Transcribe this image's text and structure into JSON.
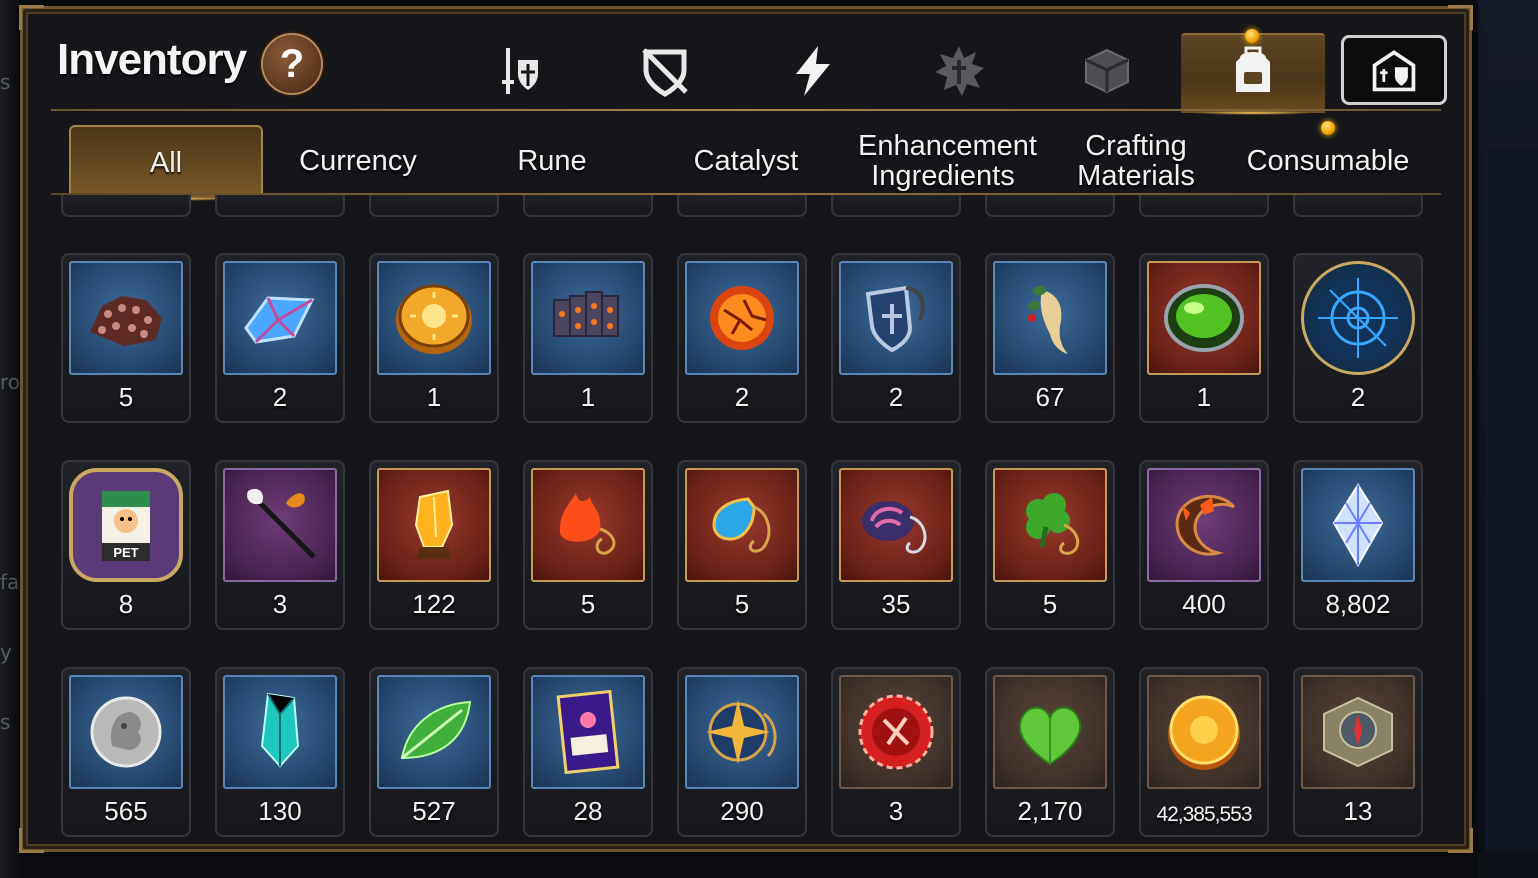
{
  "window": {
    "title": "Inventory",
    "help_label": "?"
  },
  "top_tabs": [
    {
      "icon": "sword-shield-icon"
    },
    {
      "icon": "crossed-shield-icon"
    },
    {
      "icon": "lightning-icon"
    },
    {
      "icon": "spiked-emblem-icon"
    },
    {
      "icon": "cube-icon"
    },
    {
      "icon": "backpack-icon",
      "active": true
    },
    {
      "icon": "castle-icon"
    }
  ],
  "sub_tabs": [
    {
      "label": "All",
      "active": true
    },
    {
      "label": "Currency"
    },
    {
      "label": "Rune"
    },
    {
      "label": "Catalyst"
    },
    {
      "label": "Enhancement Ingredients"
    },
    {
      "label": "Crafting Materials"
    },
    {
      "label": "Consumable"
    }
  ],
  "items": {
    "row1": [
      {
        "icon": "ore-chunk-icon",
        "count": "5"
      },
      {
        "icon": "blue-crystal-icon",
        "count": "2"
      },
      {
        "icon": "sun-coin-icon",
        "count": "1"
      },
      {
        "icon": "dark-blocks-icon",
        "count": "1"
      },
      {
        "icon": "fire-orb-icon",
        "count": "2"
      },
      {
        "icon": "blue-shield-badge-icon",
        "count": "2"
      },
      {
        "icon": "ginseng-root-icon",
        "count": "67"
      },
      {
        "icon": "green-orb-icon",
        "count": "1"
      },
      {
        "icon": "rune-circle-icon",
        "count": "2"
      }
    ],
    "row2": [
      {
        "icon": "pet-food-icon",
        "count": "8",
        "label": "PET"
      },
      {
        "icon": "feather-wand-icon",
        "count": "3"
      },
      {
        "icon": "fire-crystal-icon",
        "count": "122"
      },
      {
        "icon": "flame-pendant-icon",
        "count": "5"
      },
      {
        "icon": "water-pendant-icon",
        "count": "5"
      },
      {
        "icon": "wind-pendant-icon",
        "count": "35"
      },
      {
        "icon": "leaf-pendant-icon",
        "count": "5"
      },
      {
        "icon": "crescent-charm-icon",
        "count": "400"
      },
      {
        "icon": "diamond-shard-icon",
        "count": "8,802"
      }
    ],
    "row3": [
      {
        "icon": "silver-coin-icon",
        "count": "565"
      },
      {
        "icon": "teal-crystal-icon",
        "count": "130"
      },
      {
        "icon": "green-leaf-icon",
        "count": "527"
      },
      {
        "icon": "certificate-icon",
        "count": "28"
      },
      {
        "icon": "star-compass-icon",
        "count": "290"
      },
      {
        "icon": "red-seal-icon",
        "count": "3"
      },
      {
        "icon": "green-heart-icon",
        "count": "2,170"
      },
      {
        "icon": "gold-coin-icon",
        "count": "42,385,553"
      },
      {
        "icon": "stone-compass-icon",
        "count": "13"
      }
    ]
  },
  "colors": {
    "accent_gold": "#a0824b",
    "notif": "#f5a300",
    "frame_blue": "#5b87b8",
    "frame_red": "#c69b58"
  }
}
